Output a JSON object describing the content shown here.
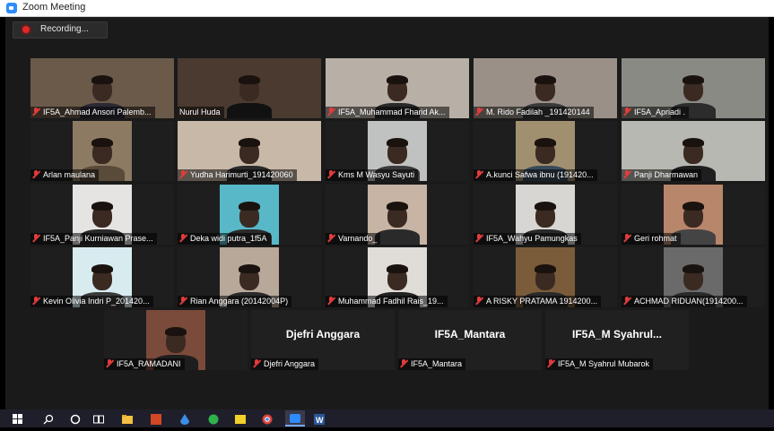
{
  "window": {
    "title": "Zoom Meeting"
  },
  "recording": {
    "label": "Recording..."
  },
  "participants": [
    {
      "name": "IF5A_Ahmad Ansori Palemb...",
      "bg": "#6b5a4a",
      "shirt": "#2a2a35"
    },
    {
      "name": "Nurul Huda",
      "bg": "#4a3a30",
      "shirt": "#111111",
      "active": true
    },
    {
      "name": "IF5A_Muhammad Fharid Ak...",
      "bg": "#b8b0a6",
      "shirt": "#2a2a2a"
    },
    {
      "name": "M. Rido Fadilah _191420144",
      "bg": "#9a9088",
      "shirt": "#3a3a3a"
    },
    {
      "name": "IF5A_Apriadi .",
      "bg": "#8a8a84",
      "shirt": "#2c2c2c"
    },
    {
      "name": "Arlan maulana",
      "bg": "#8c7a62",
      "shirt": "#5a4a3a"
    },
    {
      "name": "Yudha Harimurti_191420060",
      "bg": "#c8b8a8",
      "shirt": "#2a2a2a"
    },
    {
      "name": "Kms M Wasyu Sayuti",
      "bg": "#bfc2c0",
      "shirt": "#3a3a3a"
    },
    {
      "name": "A.kunci Safwa ibnu (191420...",
      "bg": "#a09070",
      "shirt": "#3a4a5a"
    },
    {
      "name": "Panji Dharmawan",
      "bg": "#b8b8b2",
      "shirt": "#1e1e1e"
    },
    {
      "name": "IF5A_Panji Kurniawan Prase...",
      "bg": "#e6e4e2",
      "shirt": "#2a2a2a"
    },
    {
      "name": "Deka widi putra_1f5A",
      "bg": "#58b8c8",
      "shirt": "#2a2a2a"
    },
    {
      "name": "Varnando_",
      "bg": "#c8b4a4",
      "shirt": "#2a2a2a"
    },
    {
      "name": "IF5A_Wahyu Pamungkas",
      "bg": "#d8d6d2",
      "shirt": "#2a2a2a"
    },
    {
      "name": "Geri rohmat",
      "bg": "#b8866a",
      "shirt": "#444444"
    },
    {
      "name": "Kevin Olivia Indri P_201420...",
      "bg": "#d8ecf0",
      "shirt": "#3a3a3a"
    },
    {
      "name": "Rian Anggara (20142004P)",
      "bg": "#b8a89a",
      "shirt": "#2a2a2a"
    },
    {
      "name": "Muhammad Fadhil Rais_19...",
      "bg": "#e0dcd8",
      "shirt": "#222222"
    },
    {
      "name": "A RISKY PRATAMA 1914200...",
      "bg": "#7a5c3a",
      "shirt": "#2a2a2a"
    },
    {
      "name": "ACHMAD RIDUAN(1914200...",
      "bg": "#6a6a6a",
      "shirt": "#2a2a2a"
    },
    {
      "name": "IF5A_RAMADANI",
      "bg": "#7a4a3a",
      "shirt": "#1e1e1e"
    },
    {
      "name": "Djefri Anggara",
      "bigname": "Djefri Anggara"
    },
    {
      "name": "IF5A_Mantara",
      "bigname": "IF5A_Mantara"
    },
    {
      "name": "IF5A_M Syahrul Mubarok",
      "bigname": "IF5A_M Syahrul..."
    }
  ],
  "colors": {
    "accent": "#2d8cff",
    "active_border": "#c6e05a",
    "muted_mic": "#e23b3b"
  }
}
